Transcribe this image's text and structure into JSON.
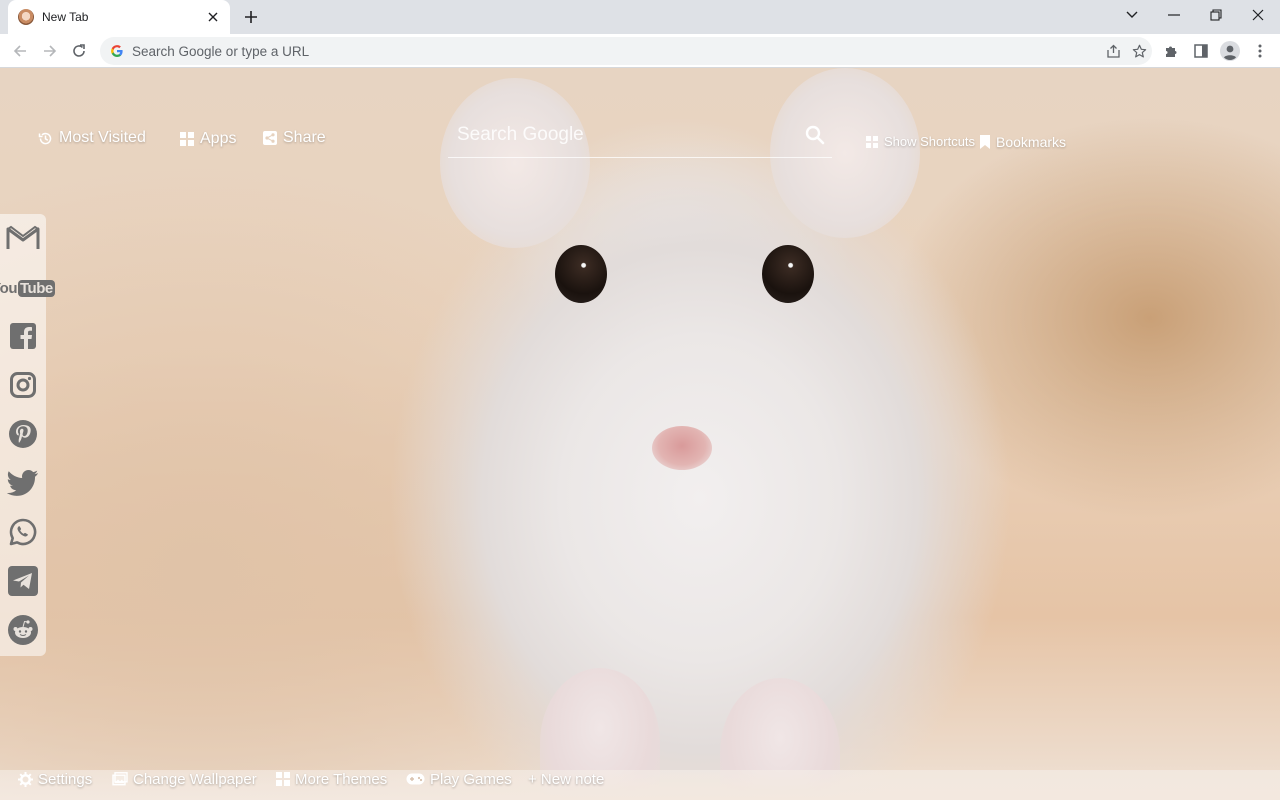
{
  "browser": {
    "tab_title": "New Tab",
    "omnibox_placeholder": "Search Google or type a URL"
  },
  "top_nav": {
    "most_visited": "Most Visited",
    "apps": "Apps",
    "share": "Share",
    "show_shortcuts": "Show Shortcuts",
    "bookmarks": "Bookmarks"
  },
  "search": {
    "placeholder": "Search Google"
  },
  "social_sidebar": {
    "items": [
      "gmail",
      "youtube",
      "facebook",
      "instagram",
      "pinterest",
      "twitter",
      "whatsapp",
      "telegram",
      "reddit"
    ],
    "youtube_logo": {
      "you": "You",
      "tube": "Tube"
    }
  },
  "bottom_bar": {
    "settings": "Settings",
    "change_wallpaper": "Change Wallpaper",
    "more_themes": "More Themes",
    "play_games": "Play Games",
    "new_note": "+ New note"
  },
  "colors": {
    "overlay_text": "#ffffff",
    "toolbar_icon": "#5f6368",
    "tabstrip_bg": "#dee1e6",
    "social_icon": "#6f6f6f"
  }
}
